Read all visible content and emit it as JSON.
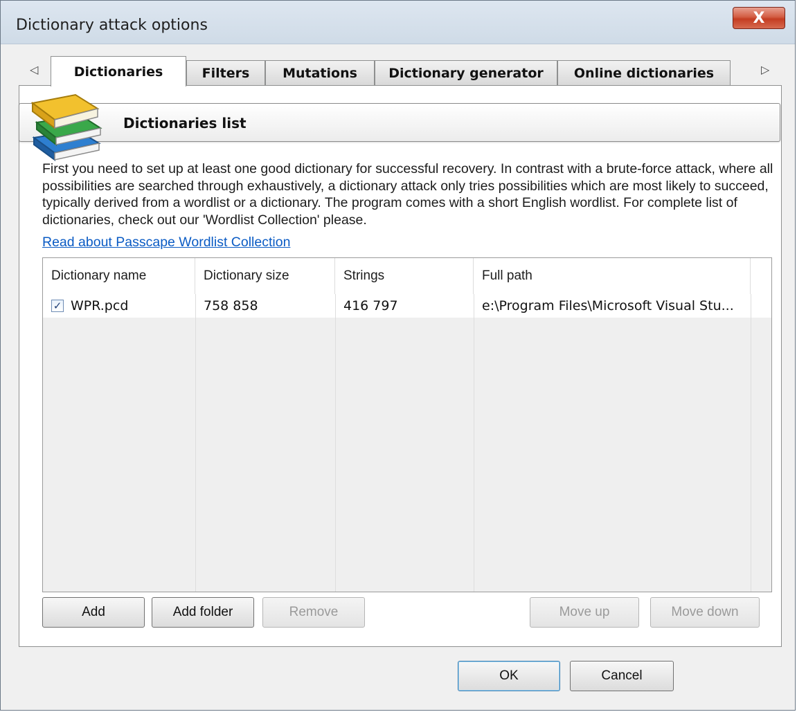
{
  "window": {
    "title": "Dictionary attack options",
    "close_glyph": "X"
  },
  "tabs": {
    "scroll_left": "◁",
    "scroll_right": "▷",
    "items": [
      {
        "label": "Dictionaries"
      },
      {
        "label": "Filters"
      },
      {
        "label": "Mutations"
      },
      {
        "label": "Dictionary generator"
      },
      {
        "label": "Online dictionaries"
      }
    ],
    "active": "Dictionaries"
  },
  "section": {
    "title": "Dictionaries list",
    "icon": "books-icon"
  },
  "description": "First you need to set up at least one good dictionary for successful recovery. In contrast with a brute-force attack, where all possibilities are searched through exhaustively, a dictionary attack only tries possibilities which are most likely to succeed, typically derived from a wordlist or a dictionary. The program comes with a short English wordlist. For complete list of dictionaries, check out our 'Wordlist Collection' please.",
  "link": "Read about Passcape Wordlist Collection",
  "grid": {
    "columns": [
      "Dictionary name",
      "Dictionary size",
      "Strings",
      "Full path"
    ],
    "rows": [
      {
        "checked": true,
        "check_glyph": "✓",
        "name": "WPR.pcd",
        "size": "758 858",
        "strings": "416 797",
        "path": "e:\\Program Files\\Microsoft Visual Stu..."
      }
    ]
  },
  "list_buttons": {
    "add": "Add",
    "add_folder": "Add folder",
    "remove": "Remove",
    "move_up": "Move up",
    "move_down": "Move down"
  },
  "dialog_buttons": {
    "ok": "OK",
    "cancel": "Cancel"
  },
  "colors": {
    "link": "#0a5bc4",
    "close_button": "#c43d22",
    "book_yellow": "#f2c12e",
    "book_green": "#3aa84a",
    "book_blue": "#2e7fd0"
  }
}
